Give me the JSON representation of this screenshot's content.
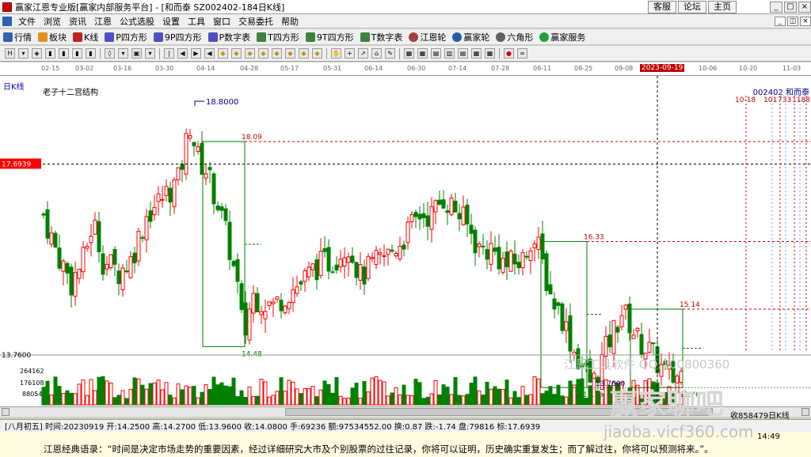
{
  "window": {
    "title": "赢家江恩专业版[赢家内部服务平台] - [和而泰  SZ002402-184日K线]",
    "title_buttons": [
      "客服",
      "论坛",
      "主页"
    ]
  },
  "menu": [
    "文件",
    "浏览",
    "资讯",
    "江恩",
    "公式选股",
    "设置",
    "工具",
    "窗口",
    "交易委托",
    "帮助"
  ],
  "toolbar": [
    "行情",
    "板块",
    "K线",
    "P四方形",
    "9P四方形",
    "P数字表",
    "T四方形",
    "9T四方形",
    "T数字表",
    "江恩轮",
    "赢家轮",
    "六角形",
    "赢家服务"
  ],
  "period_label": "日K线",
  "indicator_name": "老子十二宫结构",
  "stock": {
    "code": "002402",
    "name": "和而泰"
  },
  "date_axis": [
    "02-15",
    "03-02",
    "03-16",
    "03-30",
    "04-14",
    "04-28",
    "05-17",
    "05-31",
    "06-14",
    "06-30",
    "07-14",
    "07-28",
    "08-11",
    "08-25",
    "09-08",
    "10-06",
    "10-20",
    "11-03"
  ],
  "cursor_date": "2023-09-19",
  "future_labels": [
    "10-18",
    "101",
    "733",
    "1188"
  ],
  "price_labels": {
    "cursor_price": "17.6939",
    "high": "18.8000",
    "low_mark": "13.7600",
    "box1_top": "18.09",
    "box1_bottom": "14.48",
    "box2_top": "16.33",
    "box2_bottom": "13.76",
    "box3_top": "15.14",
    "box3_bottom": "13.76",
    "volume_top": "13.7600"
  },
  "volume_axis": [
    "264162",
    "176108",
    "88054"
  ],
  "status": "[八月初五] 时间:20230919 开:14.2500 高:14.2700 低:13.9600 收:14.0800 手:69236 额:97534552.00 换:0.87 跌:-1.74 盘:79816 标:17.6939",
  "status_right": "收858479日K线",
  "clock": "14:49",
  "quote": "江恩经典语录：“时间是决定市场走势的重要因素，经过详细研究大市及个别股票的过往记录，你将可以证明，历史确实重复发生；而了解过往，你将可以预测将来。”。",
  "watermark": {
    "text1": "江恩工具软件 QQ:100800360",
    "text2": "赢家聊吧",
    "text3": "jiaoba.vicf360.com"
  },
  "colors": {
    "up": "#ff0000",
    "down": "#008000",
    "box": "#008000",
    "dash": "#c80000",
    "accent": "#ff0000"
  }
}
